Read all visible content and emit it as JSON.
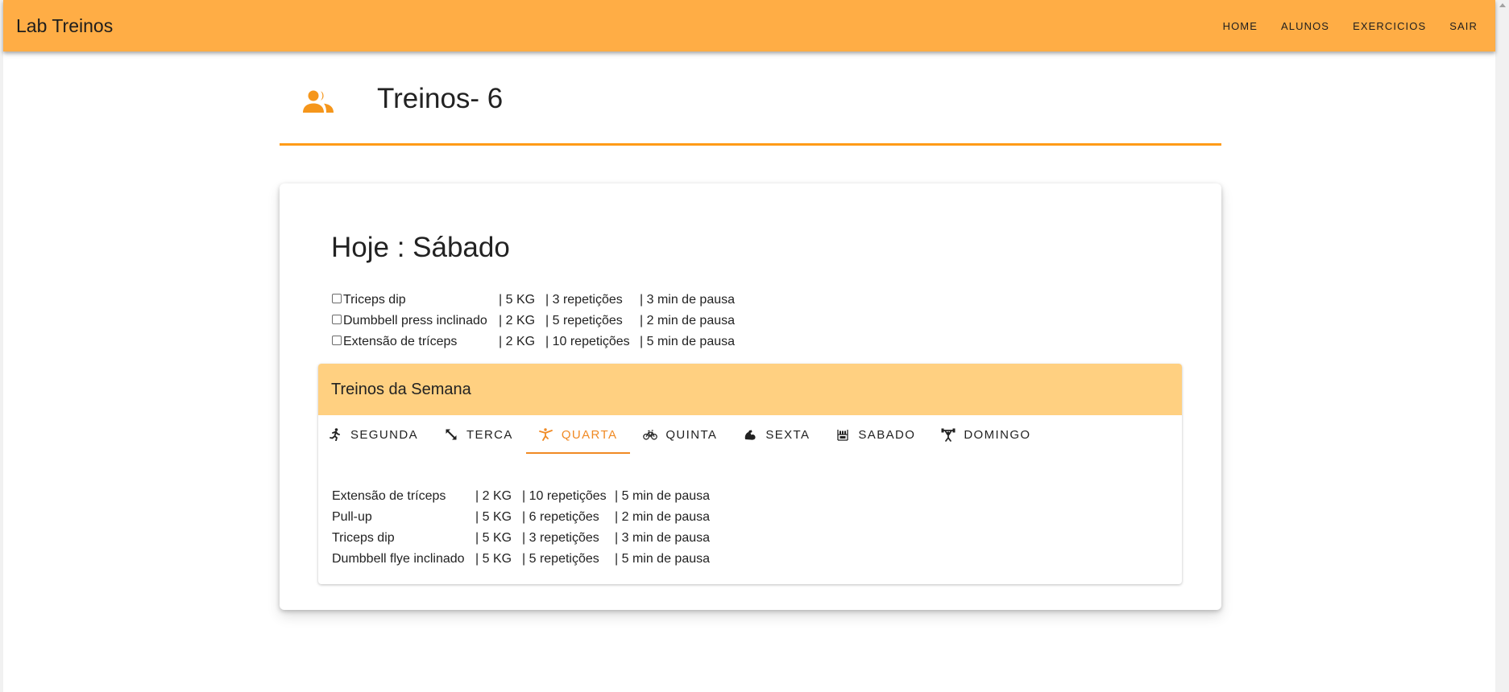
{
  "app": {
    "title": "Lab Treinos",
    "accent": "#ffad45",
    "active_color": "#f08a24",
    "nav": [
      {
        "label": "HOME"
      },
      {
        "label": "ALUNOS"
      },
      {
        "label": "EXERCICIOS"
      },
      {
        "label": "SAIR"
      }
    ]
  },
  "page": {
    "icon": "people-icon",
    "title": "Treinos- 6"
  },
  "today": {
    "title": "Hoje : Sábado",
    "items": [
      {
        "name": "Triceps dip",
        "kg": "| 5 KG",
        "reps": "| 3 repetições",
        "pause": "| 3 min de pausa",
        "checked": false
      },
      {
        "name": "Dumbbell press inclinado",
        "kg": "| 2 KG",
        "reps": "| 5 repetições",
        "pause": "| 2 min de pausa",
        "checked": false
      },
      {
        "name": "Extensão de tríceps",
        "kg": "| 2 KG",
        "reps": "| 10 repetições",
        "pause": "| 5 min de pausa",
        "checked": false
      }
    ]
  },
  "week": {
    "title": "Treinos da Semana",
    "header_color": "#ffd081",
    "tabs": [
      {
        "label": "SEGUNDA",
        "icon": "running-icon"
      },
      {
        "label": "TERCA",
        "icon": "expand-arrows-icon"
      },
      {
        "label": "QUARTA",
        "icon": "kicking-icon",
        "active": true
      },
      {
        "label": "QUINTA",
        "icon": "bicycle-icon"
      },
      {
        "label": "SEXTA",
        "icon": "flexed-arm-icon"
      },
      {
        "label": "SABADO",
        "icon": "weights-rack-icon"
      },
      {
        "label": "DOMINGO",
        "icon": "weightlifter-icon"
      }
    ],
    "items": [
      {
        "name": "Extensão de tríceps",
        "kg": "| 2 KG",
        "reps": "| 10 repetições",
        "pause": "| 5 min de pausa"
      },
      {
        "name": "Pull-up",
        "kg": "| 5 KG",
        "reps": "| 6 repetições",
        "pause": "| 2 min de pausa"
      },
      {
        "name": "Triceps dip",
        "kg": "| 5 KG",
        "reps": "| 3 repetições",
        "pause": "| 3 min de pausa"
      },
      {
        "name": "Dumbbell flye inclinado",
        "kg": "| 5 KG",
        "reps": "| 5 repetições",
        "pause": "| 5 min de pausa"
      }
    ]
  }
}
